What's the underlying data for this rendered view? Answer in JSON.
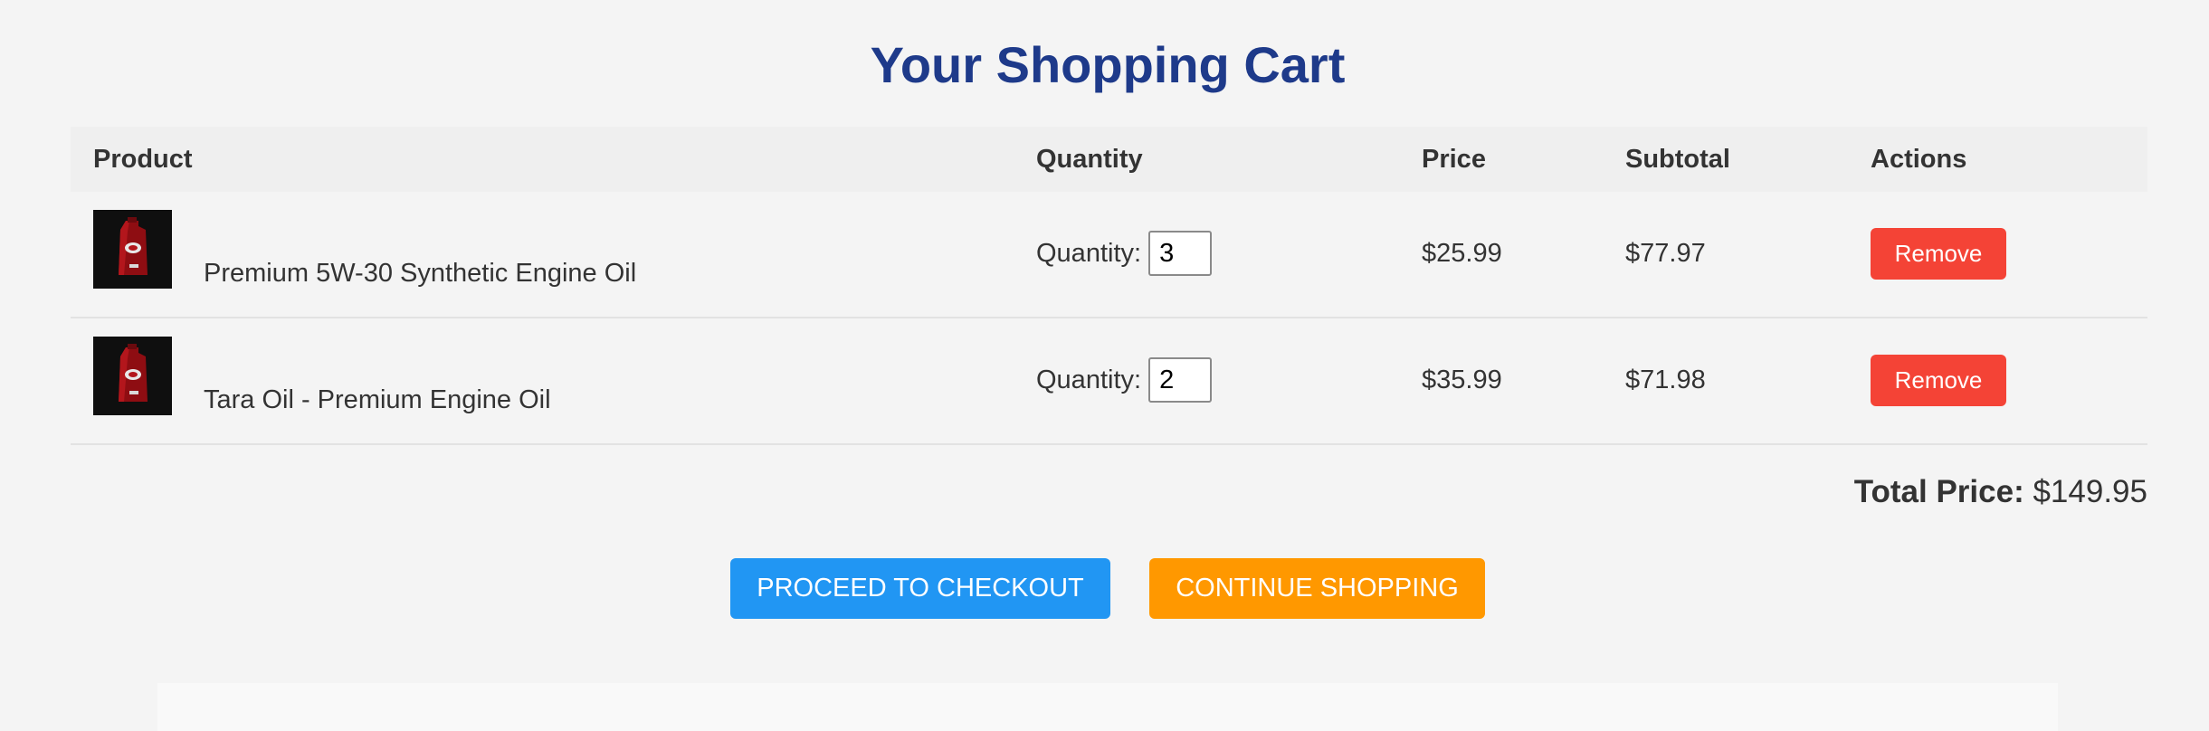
{
  "page": {
    "title": "Your Shopping Cart"
  },
  "table": {
    "headers": {
      "product": "Product",
      "quantity": "Quantity",
      "price": "Price",
      "subtotal": "Subtotal",
      "actions": "Actions"
    },
    "rows": [
      {
        "name": "Premium 5W-30 Synthetic Engine Oil",
        "quantity_label": "Quantity:",
        "quantity": "3",
        "price": "$25.99",
        "subtotal": "$77.97",
        "remove_label": "Remove",
        "thumbnail_icon": "engine-oil-bottle-icon"
      },
      {
        "name": "Tara Oil - Premium Engine Oil",
        "quantity_label": "Quantity:",
        "quantity": "2",
        "price": "$35.99",
        "subtotal": "$71.98",
        "remove_label": "Remove",
        "thumbnail_icon": "engine-oil-bottle-icon"
      }
    ]
  },
  "summary": {
    "total_label": "Total Price:",
    "total_value": "$149.95"
  },
  "actions": {
    "checkout_label": "PROCEED TO CHECKOUT",
    "continue_label": "CONTINUE SHOPPING"
  },
  "colors": {
    "title": "#1e3a8a",
    "remove": "#f44336",
    "checkout": "#2196f3",
    "continue": "#ff9800",
    "background": "#f4f4f4"
  }
}
